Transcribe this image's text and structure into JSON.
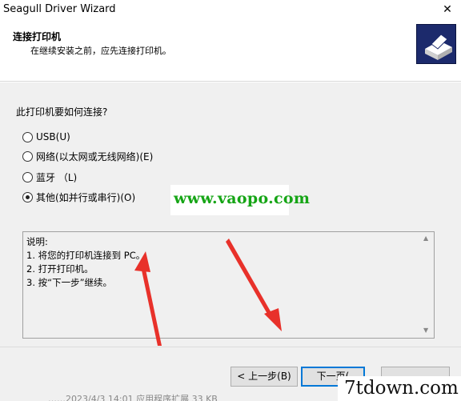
{
  "window": {
    "title": "Seagull Driver Wizard",
    "close_glyph": "✕"
  },
  "header": {
    "title": "连接打印机",
    "subtitle": "在继续安装之前，应先连接打印机。",
    "logo_icon": "printer-icon",
    "logo_color": "#1c2a6c"
  },
  "question": "此打印机要如何连接?",
  "options": [
    {
      "label": "USB(U)",
      "checked": false
    },
    {
      "label": "网络(以太网或无线网络)(E)",
      "checked": false
    },
    {
      "label": "蓝牙 （L)",
      "checked": false
    },
    {
      "label": "其他(如并行或串行)(O)",
      "checked": true
    }
  ],
  "watermark": "www.vaopo.com",
  "description": {
    "lines": [
      "说明:",
      "1. 将您的打印机连接到 PC。",
      "2. 打开打印机。",
      "3. 按“下一步”继续。"
    ]
  },
  "buttons": {
    "back": "< 上一步(B)",
    "next": "下一页("
  },
  "footer_watermark": "7tdown.com",
  "footer_partial_text": "……2023/4/3 14:01        应用程序扩展          33 KB",
  "colors": {
    "watermark_green": "#16a516",
    "arrow_red": "#e8312a",
    "accent": "#0078d7"
  }
}
